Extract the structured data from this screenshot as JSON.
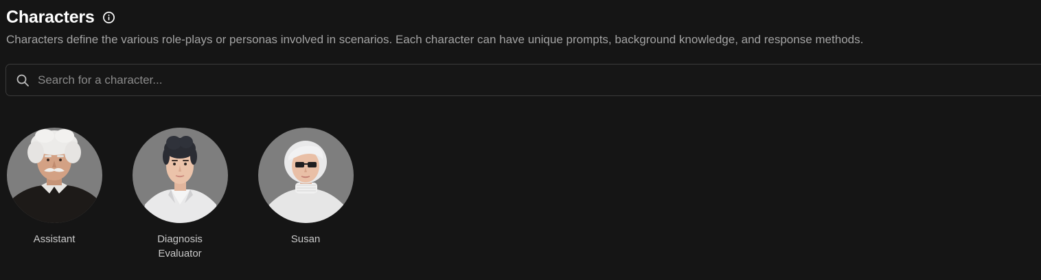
{
  "header": {
    "title": "Characters",
    "info_icon": "info-icon",
    "description": "Characters define the various role-plays or personas involved in scenarios. Each character can have unique prompts, background knowledge, and response methods."
  },
  "search": {
    "icon": "search-icon",
    "placeholder": "Search for a character...",
    "value": ""
  },
  "characters": [
    {
      "name": "Assistant",
      "avatar": "elderly-man-white-hair-mustache-avatar"
    },
    {
      "name": "Diagnosis Evaluator",
      "avatar": "woman-dark-hair-lab-coat-avatar"
    },
    {
      "name": "Susan",
      "avatar": "woman-white-hair-sunglasses-avatar"
    }
  ],
  "colors": {
    "background": "#151515",
    "title": "#ffffff",
    "muted_text": "#a3a3a3",
    "avatar_bg": "#7e7e7e",
    "border": "#3b3b3b"
  }
}
